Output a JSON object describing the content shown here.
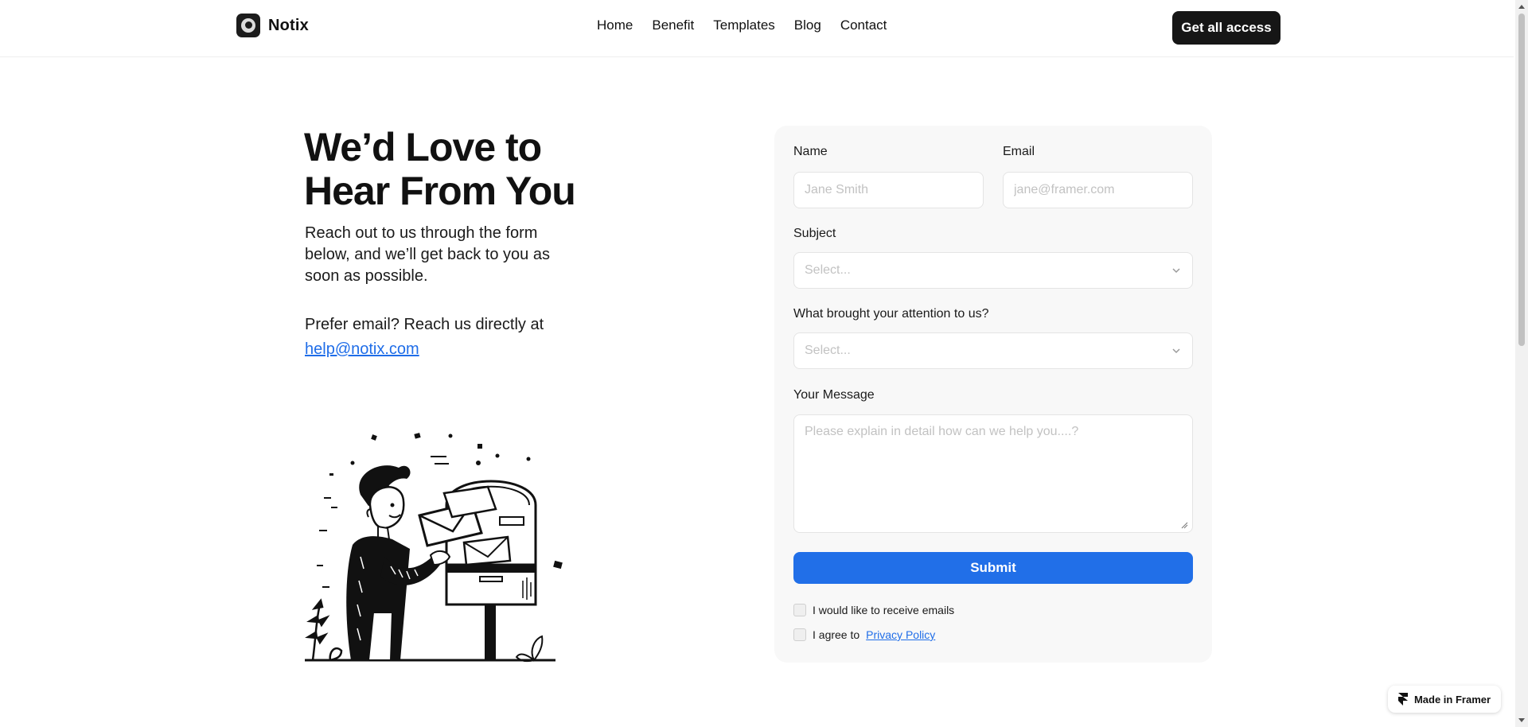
{
  "header": {
    "brand_name": "Notix",
    "nav": [
      "Home",
      "Benefit",
      "Templates",
      "Blog",
      "Contact"
    ],
    "cta_label": "Get all access"
  },
  "hero": {
    "title_line1": "We’d Love to",
    "title_line2": "Hear From You",
    "subtitle": "Reach out to us through the form below, and we’ll get back to you as soon as possible.",
    "email_prompt": "Prefer email? Reach us directly at",
    "email": "help@notix.com"
  },
  "form": {
    "name_label": "Name",
    "name_placeholder": "Jane Smith",
    "email_label": "Email",
    "email_placeholder": "jane@framer.com",
    "subject_label": "Subject",
    "subject_placeholder": "Select...",
    "attention_label": "What brought your attention to us?",
    "attention_placeholder": "Select...",
    "message_label": "Your Message",
    "message_placeholder": "Please explain in detail how can we help you....?",
    "submit_label": "Submit",
    "receive_emails_label": "I would like to receive emails",
    "agree_prefix": "I agree to",
    "privacy_link": "Privacy Policy"
  },
  "badge": {
    "label": "Made in Framer"
  },
  "colors": {
    "accent": "#216fe8",
    "dark": "#161616",
    "card": "#f8f8f8"
  }
}
